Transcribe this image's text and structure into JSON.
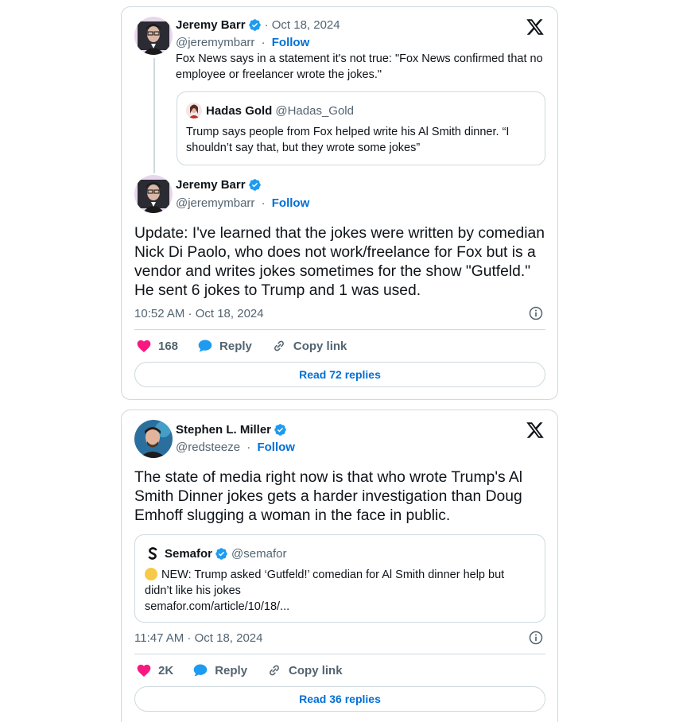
{
  "colors": {
    "accent": "#006fd6",
    "like": "#f91880",
    "verified": "#1d9bf0",
    "muted": "#536471",
    "border": "#cfd9de"
  },
  "tweet1": {
    "parent": {
      "name": "Jeremy Barr",
      "date": "· Oct 18, 2024",
      "handle": "@jeremymbarr",
      "separator": "·",
      "follow": "Follow",
      "text": "Fox News says in a statement it's not true: \"Fox News confirmed that no employee or freelancer wrote the jokes.\"",
      "quote": {
        "name": "Hadas Gold",
        "handle": "@Hadas_Gold",
        "text": "Trump says people from Fox helped write his Al Smith dinner. “I shouldn’t say that, but they wrote some jokes”"
      }
    },
    "main": {
      "name": "Jeremy Barr",
      "handle": "@jeremymbarr",
      "separator": "·",
      "follow": "Follow",
      "text": "Update: I've learned that the jokes were written by comedian Nick Di Paolo, who does not work/freelance for Fox but is a vendor and writes jokes sometimes for the show \"Gutfeld.\" He sent 6 jokes to Trump and 1 was used.",
      "timestamp": "10:52 AM · Oct 18, 2024",
      "likes": "168",
      "reply_label": "Reply",
      "copy_label": "Copy link",
      "read_replies": "Read 72 replies"
    }
  },
  "tweet2": {
    "name": "Stephen L. Miller",
    "handle": "@redsteeze",
    "separator": "·",
    "follow": "Follow",
    "text": "The state of media right now is that who wrote Trump's Al Smith Dinner jokes gets a harder investigation than Doug Emhoff slugging a woman in the face in public.",
    "quote": {
      "name": "Semafor",
      "handle": "@semafor",
      "text": "NEW: Trump asked ‘Gutfeld!’ comedian for Al Smith dinner help but didn’t like his jokes",
      "link": "semafor.com/article/10/18/..."
    },
    "timestamp": "11:47 AM · Oct 18, 2024",
    "likes": "2K",
    "reply_label": "Reply",
    "copy_label": "Copy link",
    "read_replies": "Read 36 replies"
  },
  "icons": {
    "x_logo": "x-logo-icon",
    "verified": "verified-badge-icon",
    "like": "heart-icon",
    "reply": "speech-bubble-icon",
    "copy": "link-icon",
    "info": "info-circle-icon"
  }
}
